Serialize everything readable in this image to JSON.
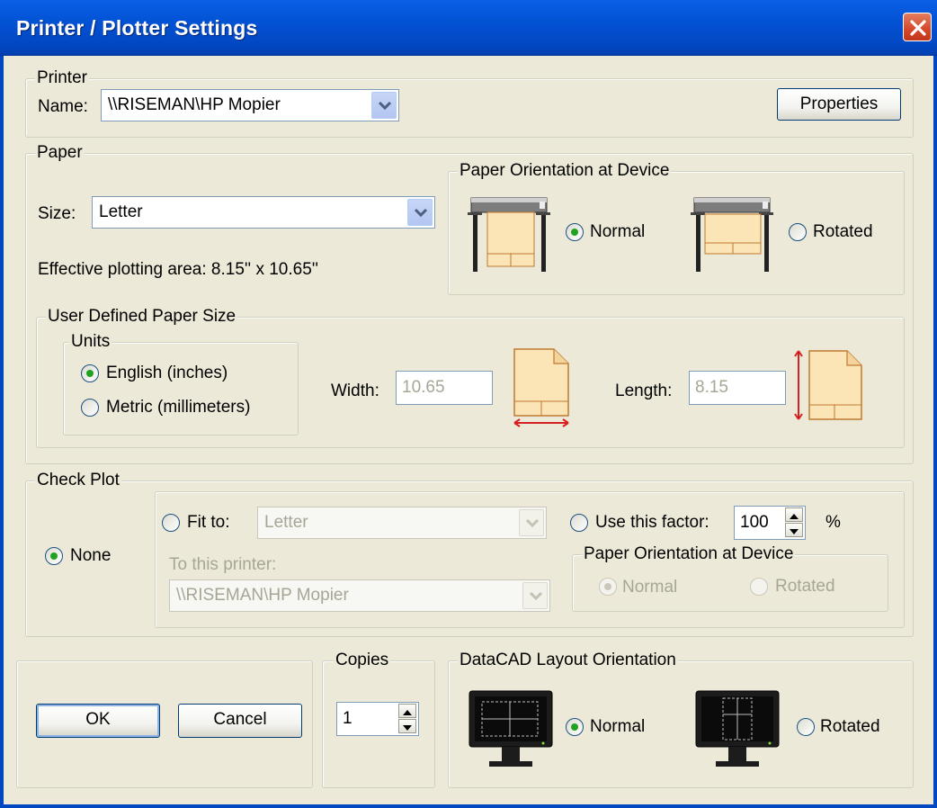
{
  "window": {
    "title": "Printer / Plotter Settings"
  },
  "printer": {
    "legend": "Printer",
    "name_label": "Name:",
    "name_value": "\\\\RISEMAN\\HP Mopier",
    "properties_button": "Properties"
  },
  "paper": {
    "legend": "Paper",
    "size_label": "Size:",
    "size_value": "Letter",
    "effective_area": "Effective plotting area: 8.15'' x 10.65''",
    "orientation": {
      "legend": "Paper Orientation at Device",
      "normal_label": "Normal",
      "rotated_label": "Rotated",
      "selected": "Normal"
    },
    "user_defined": {
      "legend": "User Defined Paper Size",
      "units_legend": "Units",
      "english_label": "English (inches)",
      "metric_label": "Metric (millimeters)",
      "selected_unit": "English (inches)",
      "width_label": "Width:",
      "width_value": "10.65",
      "length_label": "Length:",
      "length_value": "8.15"
    }
  },
  "check_plot": {
    "legend": "Check Plot",
    "none_label": "None",
    "fit_to_label": "Fit to:",
    "fit_to_value": "Letter",
    "to_printer_label": "To this printer:",
    "to_printer_value": "\\\\RISEMAN\\HP Mopier",
    "factor_label": "Use this factor:",
    "factor_value": "100",
    "percent": "%",
    "selected": "None",
    "orientation": {
      "legend": "Paper Orientation at Device",
      "normal_label": "Normal",
      "rotated_label": "Rotated"
    }
  },
  "buttons": {
    "ok": "OK",
    "cancel": "Cancel"
  },
  "copies": {
    "legend": "Copies",
    "value": "1"
  },
  "layout": {
    "legend": "DataCAD Layout Orientation",
    "normal_label": "Normal",
    "rotated_label": "Rotated",
    "selected": "Normal"
  },
  "icons": {
    "close": "close-icon",
    "combo_arrow": "chevron-down-icon",
    "plotter": "plotter-icon",
    "paper_page": "paper-page-icon",
    "monitor": "monitor-icon"
  },
  "colors": {
    "titlebar": "#0352d4",
    "window_bg": "#ece9d8",
    "radio_checked": "#21a121",
    "dimension_arrow": "#d42020"
  }
}
